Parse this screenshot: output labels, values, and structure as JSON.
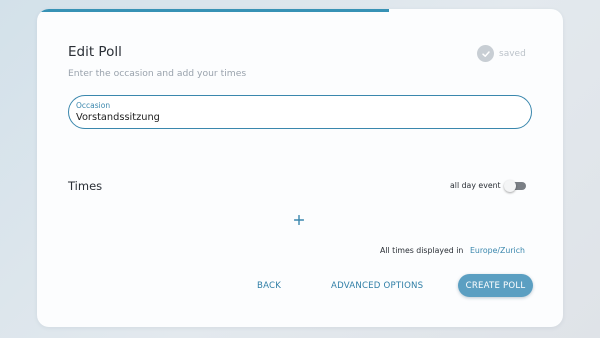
{
  "progress": {
    "fraction": 0.67,
    "color": "#3792b5"
  },
  "header": {
    "title": "Edit Poll",
    "subtitle": "Enter the occasion and add your times",
    "saved_label": "saved"
  },
  "occasion": {
    "label": "Occasion",
    "value": "Vorstandssitzung"
  },
  "times": {
    "heading": "Times",
    "all_day_label": "all day event",
    "all_day_enabled": false,
    "add_icon": "plus-icon"
  },
  "timezone": {
    "label": "All times displayed in",
    "value": "Europe/Zurich"
  },
  "actions": {
    "back_label": "BACK",
    "advanced_label": "ADVANCED OPTIONS",
    "create_label": "CREATE POLL"
  },
  "colors": {
    "accent": "#3a87ad",
    "primary_button": "#5b9fc2"
  }
}
